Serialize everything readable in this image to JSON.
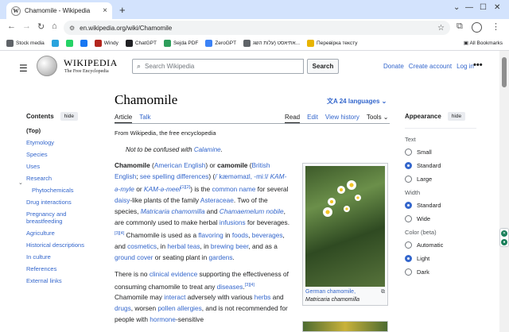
{
  "browser": {
    "tab_title": "Chamomile - Wikipedia",
    "tab_favicon": "W",
    "new_tab": "+",
    "url": "en.wikipedia.org/wiki/Chamomile",
    "bookmarks": [
      {
        "label": "Stock media",
        "color": "#5f6368",
        "icon": "folder-icon"
      },
      {
        "label": "",
        "color": "#2aa3dd",
        "icon": "telegram-icon"
      },
      {
        "label": "",
        "color": "#25d366",
        "icon": "whatsapp-icon"
      },
      {
        "label": "",
        "color": "#1877f2",
        "icon": "facebook-icon"
      },
      {
        "label": "Windy",
        "color": "#b3261e",
        "icon": "windy-icon"
      },
      {
        "label": "ChatGPT",
        "color": "#202124",
        "icon": "chatgpt-icon"
      },
      {
        "label": "Sejda PDF",
        "color": "#2e9e5b",
        "icon": "sejda-icon"
      },
      {
        "label": "ZeroGPT",
        "color": "#3b82f6",
        "icon": "zerogpt-icon"
      },
      {
        "label": "אתיאסט (עלות השג...",
        "color": "#5f6368",
        "icon": "page-icon"
      },
      {
        "label": "Перевірка тексту",
        "color": "#e8b400",
        "icon": "check-text-icon"
      }
    ],
    "all_bookmarks": "All Bookmarks"
  },
  "wiki": {
    "wordmark": "WIKIPEDIA",
    "tagline": "The Free Encyclopedia",
    "search_placeholder": "Search Wikipedia",
    "search_button": "Search",
    "top_links": [
      "Donate",
      "Create account",
      "Log in"
    ],
    "more": "•••"
  },
  "toc": {
    "title": "Contents",
    "hide": "hide",
    "items": [
      {
        "label": "(Top)",
        "level": 0,
        "top": true
      },
      {
        "label": "Etymology",
        "level": 0
      },
      {
        "label": "Species",
        "level": 0
      },
      {
        "label": "Uses",
        "level": 0
      },
      {
        "label": "Research",
        "level": 0
      },
      {
        "label": "Phytochemicals",
        "level": 1
      },
      {
        "label": "Drug interactions",
        "level": 0
      },
      {
        "label": "Pregnancy and breastfeeding",
        "level": 0
      },
      {
        "label": "Agriculture",
        "level": 0
      },
      {
        "label": "Historical descriptions",
        "level": 0
      },
      {
        "label": "In culture",
        "level": 0
      },
      {
        "label": "References",
        "level": 0
      },
      {
        "label": "External links",
        "level": 0
      }
    ]
  },
  "article": {
    "title": "Chamomile",
    "languages": "24 languages",
    "tabs_left": [
      "Article",
      "Talk"
    ],
    "tabs_right": [
      "Read",
      "Edit",
      "View history",
      "Tools"
    ],
    "from": "From Wikipedia, the free encyclopedia",
    "hatnote_prefix": "Not to be confused with ",
    "hatnote_link": "Calamine",
    "hatnote_suffix": ".",
    "infobox_caption_1": "German chamomile,",
    "infobox_caption_2": "Matricaria chamomilla"
  },
  "appearance": {
    "title": "Appearance",
    "hide": "hide",
    "text_label": "Text",
    "text_options": [
      {
        "label": "Small",
        "on": false
      },
      {
        "label": "Standard",
        "on": true
      },
      {
        "label": "Large",
        "on": false
      }
    ],
    "width_label": "Width",
    "width_options": [
      {
        "label": "Standard",
        "on": true
      },
      {
        "label": "Wide",
        "on": false
      }
    ],
    "color_label": "Color (beta)",
    "color_options": [
      {
        "label": "Automatic",
        "on": false
      },
      {
        "label": "Light",
        "on": true
      },
      {
        "label": "Dark",
        "on": false
      }
    ]
  },
  "colors": {
    "link": "#3366cc",
    "tabbar": "#d3e3fd",
    "accent": "#3366cc"
  }
}
